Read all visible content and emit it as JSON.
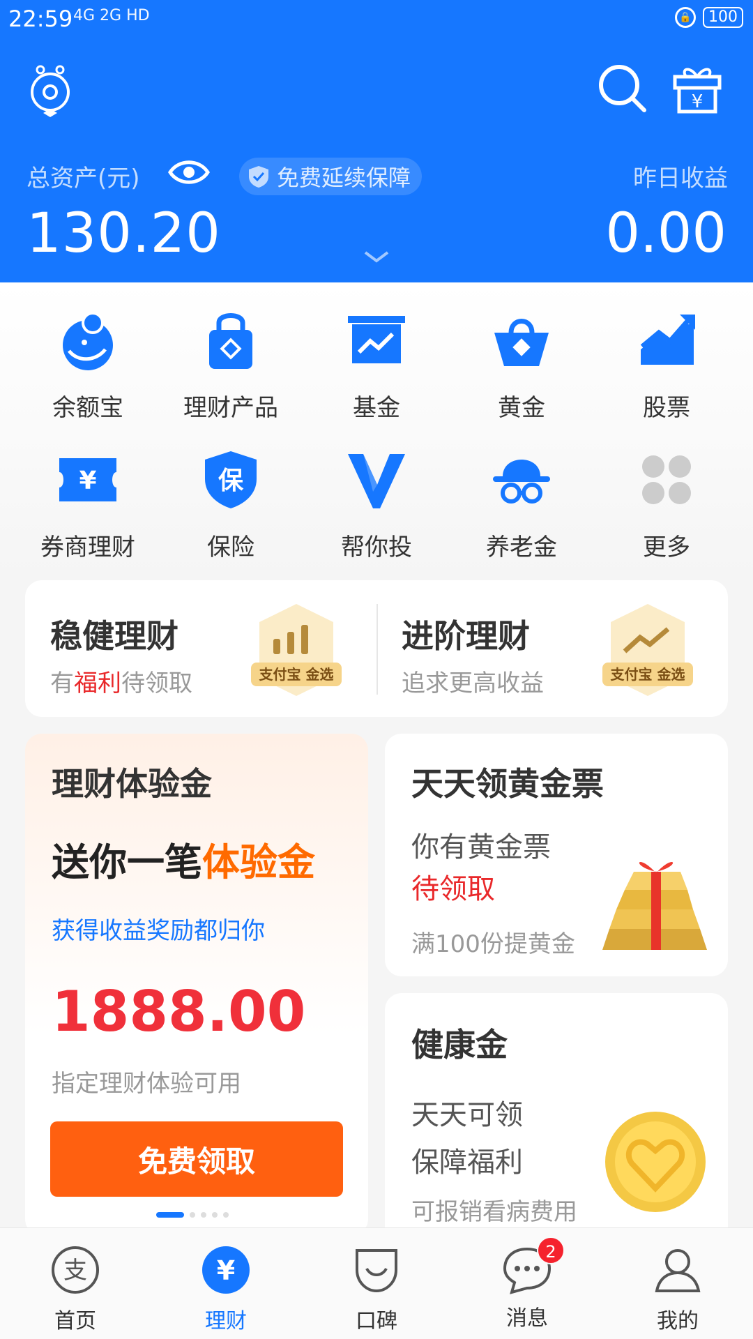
{
  "status_bar": {
    "time": "22:59",
    "network": "4G 2G HD",
    "battery": "100"
  },
  "header": {
    "total_assets_label": "总资产(元)",
    "protection_badge": "免费延续保障",
    "yesterday_income_label": "昨日收益",
    "total_assets_value": "130.20",
    "yesterday_income_value": "0.00",
    "colors": {
      "brand_blue": "#1677ff"
    }
  },
  "grid": {
    "items": [
      {
        "label": "余额宝",
        "icon": "yuebao-icon"
      },
      {
        "label": "理财产品",
        "icon": "lock-bag-icon"
      },
      {
        "label": "基金",
        "icon": "fund-chart-icon"
      },
      {
        "label": "黄金",
        "icon": "gold-basket-icon"
      },
      {
        "label": "股票",
        "icon": "stock-trend-icon"
      },
      {
        "label": "券商理财",
        "icon": "ticket-yuan-icon"
      },
      {
        "label": "保险",
        "icon": "insurance-shield-icon"
      },
      {
        "label": "帮你投",
        "icon": "v-icon"
      },
      {
        "label": "养老金",
        "icon": "grandpa-hat-icon"
      },
      {
        "label": "更多",
        "icon": "more-dots-icon"
      }
    ]
  },
  "promo": {
    "left": {
      "title": "稳健理财",
      "sub_prefix": "有",
      "sub_highlight": "福利",
      "sub_suffix": "待领取",
      "badge": "支付宝 金选"
    },
    "right": {
      "title": "进阶理财",
      "sub": "追求更高收益",
      "badge": "支付宝 金选"
    }
  },
  "experience_card": {
    "title": "理财体验金",
    "headline_prefix": "送你一笔",
    "headline_highlight": "体验金",
    "desc": "获得收益奖励都归你",
    "amount": "1888.00",
    "note": "指定理财体验可用",
    "button": "免费领取"
  },
  "gold_card": {
    "title": "天天领黄金票",
    "line1": "你有黄金票",
    "line2": "待领取",
    "line3": "满100份提黄金"
  },
  "health_card": {
    "title": "健康金",
    "line1": "天天可领",
    "line2": "保障福利",
    "line3": "可报销看病费用"
  },
  "bottom_nav": {
    "items": [
      {
        "label": "首页",
        "icon": "alipay-home-icon"
      },
      {
        "label": "理财",
        "icon": "yuan-wealth-icon"
      },
      {
        "label": "口碑",
        "icon": "koubei-smile-icon"
      },
      {
        "label": "消息",
        "icon": "message-bubble-icon",
        "badge": "2"
      },
      {
        "label": "我的",
        "icon": "user-profile-icon"
      }
    ]
  }
}
